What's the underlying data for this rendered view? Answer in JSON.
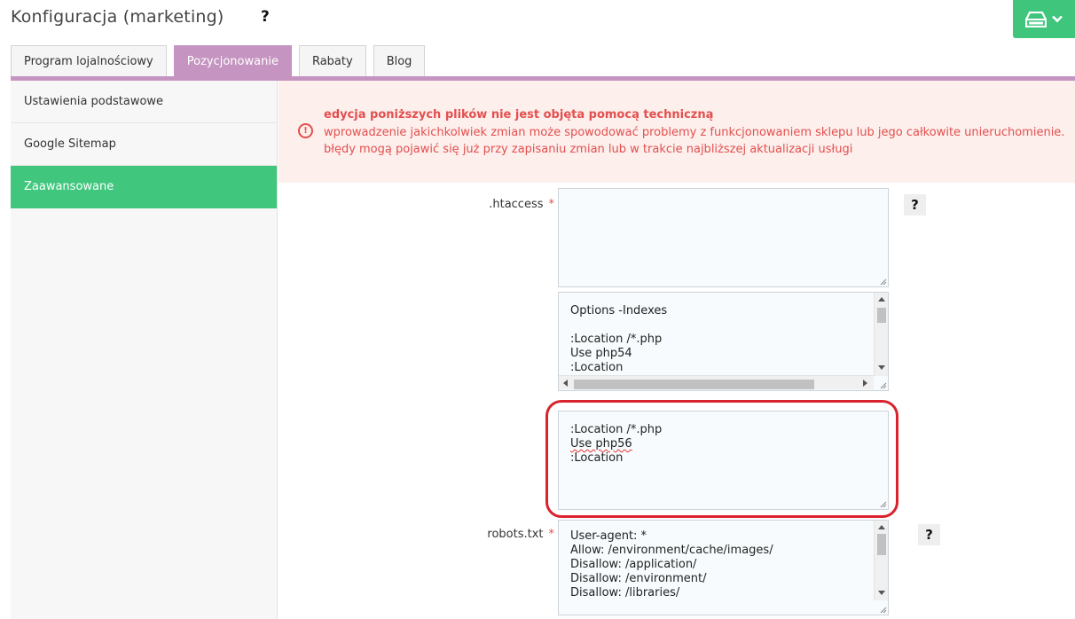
{
  "header": {
    "title": "Konfiguracja (marketing)",
    "help_label": "?",
    "save_icon": "drive-save-icon",
    "save_chevron_icon": "chevron-down-icon",
    "accent_color": "#3fc57c"
  },
  "tabs": [
    {
      "label": "Program lojalnościowy",
      "active": false
    },
    {
      "label": "Pozycjonowanie",
      "active": true
    },
    {
      "label": "Rabaty",
      "active": false
    },
    {
      "label": "Blog",
      "active": false
    }
  ],
  "sidebar": {
    "items": [
      {
        "label": "Ustawienia podstawowe",
        "active": false
      },
      {
        "label": "Google Sitemap",
        "active": false
      },
      {
        "label": "Zaawansowane",
        "active": true
      }
    ]
  },
  "alert": {
    "icon": "exclamation-circle-icon",
    "title": "edycja poniższych plików nie jest objęta pomocą techniczną",
    "line1": "wprowadzenie jakichkolwiek zmian może spowodować problemy z funkcjonowaniem sklepu lub jego całkowite unieruchomienie.",
    "line2": "błędy mogą pojawić się już przy zapisaniu zmian lub w trakcie najbliższej aktualizacji usługi",
    "color": "#e44f4f"
  },
  "htaccess": {
    "label": ".htaccess",
    "required_mark": "*",
    "help_label": "?",
    "box1_value": "",
    "box2_lines": [
      "Options -Indexes",
      "",
      ":Location /*.php",
      "Use php54",
      ":Location"
    ],
    "box3_lines": [
      ":Location /*.php",
      "Use php56",
      ":Location"
    ]
  },
  "robots": {
    "label": "robots.txt",
    "required_mark": "*",
    "help_label": "?",
    "lines": [
      "User-agent: *",
      "Allow: /environment/cache/images/",
      "Disallow: /application/",
      "Disallow: /environment/",
      "Disallow: /libraries/"
    ]
  },
  "highlight_color": "#d9232e"
}
